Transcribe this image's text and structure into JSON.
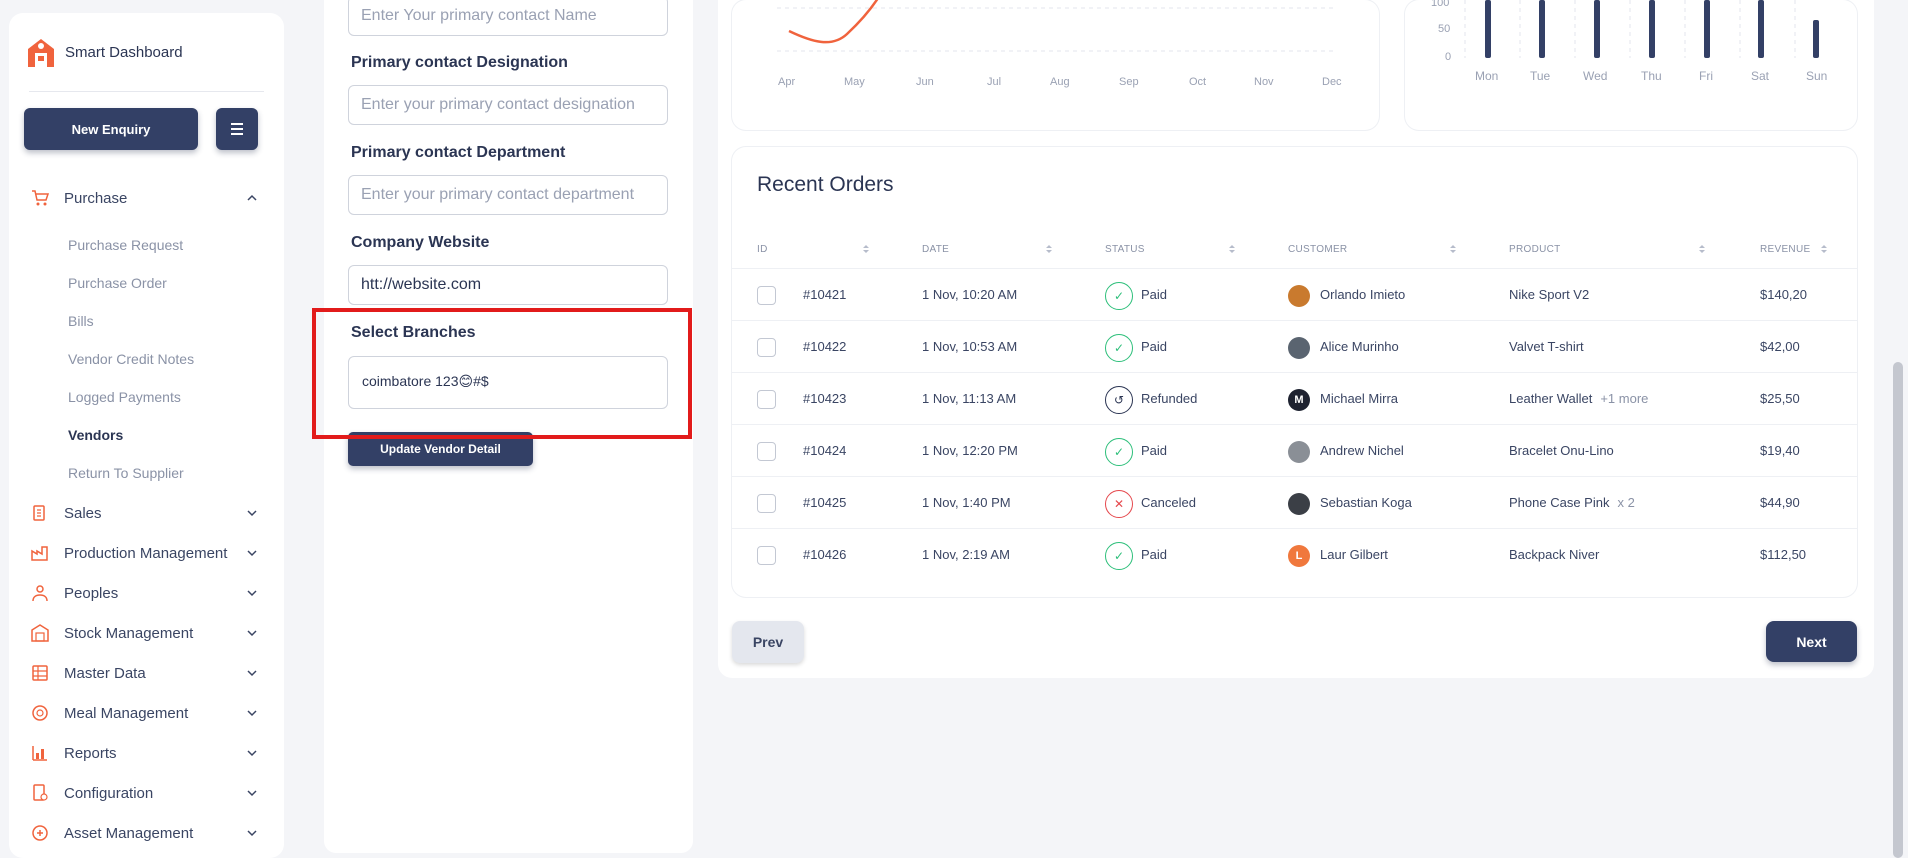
{
  "app": {
    "title": "Smart Dashboard"
  },
  "colors": {
    "primary": "#334066",
    "accent": "#f0633d",
    "success": "#2dbf7a",
    "danger": "#e5484d",
    "highlight": "#e21b1b"
  },
  "sidebar": {
    "new_enquiry_label": "New Enquiry",
    "menu": [
      {
        "label": "Purchase",
        "icon": "cart-icon",
        "expanded": true,
        "children": [
          "Purchase Request",
          "Purchase Order",
          "Bills",
          "Vendor Credit Notes",
          "Logged Payments",
          "Vendors",
          "Return To Supplier"
        ],
        "active_child": "Vendors"
      },
      {
        "label": "Sales",
        "icon": "sales-icon"
      },
      {
        "label": "Production Management",
        "icon": "factory-icon"
      },
      {
        "label": "Peoples",
        "icon": "people-icon"
      },
      {
        "label": "Stock Management",
        "icon": "warehouse-icon"
      },
      {
        "label": "Master Data",
        "icon": "database-icon"
      },
      {
        "label": "Meal Management",
        "icon": "meal-icon"
      },
      {
        "label": "Reports",
        "icon": "reports-icon"
      },
      {
        "label": "Configuration",
        "icon": "config-icon"
      },
      {
        "label": "Asset Management",
        "icon": "asset-icon"
      }
    ]
  },
  "form": {
    "contact_name_placeholder": "Enter Your primary contact Name",
    "designation_label": "Primary contact Designation",
    "designation_placeholder": "Enter your primary contact designation",
    "department_label": "Primary contact Department",
    "department_placeholder": "Enter your primary contact department",
    "website_label": "Company Website",
    "website_value": "htt://website.com",
    "branches_label": "Select Branches",
    "branches_value": "coimbatore 123😊#$",
    "update_button": "Update Vendor Detail"
  },
  "line_chart": {
    "months": [
      "Apr",
      "May",
      "Jun",
      "Jul",
      "Aug",
      "Sep",
      "Oct",
      "Nov",
      "Dec"
    ]
  },
  "bar_chart": {
    "y_ticks": [
      "100",
      "50",
      "0"
    ],
    "days": [
      "Mon",
      "Tue",
      "Wed",
      "Thu",
      "Fri",
      "Sat",
      "Sun"
    ]
  },
  "orders": {
    "title": "Recent Orders",
    "columns": [
      "ID",
      "DATE",
      "STATUS",
      "CUSTOMER",
      "PRODUCT",
      "REVENUE"
    ],
    "rows": [
      {
        "id": "#10421",
        "date": "1 Nov, 10:20 AM",
        "status": "Paid",
        "customer": "Orlando Imieto",
        "product": "Nike Sport V2",
        "extra": "",
        "revenue": "$140,20"
      },
      {
        "id": "#10422",
        "date": "1 Nov, 10:53 AM",
        "status": "Paid",
        "customer": "Alice Murinho",
        "product": "Valvet T-shirt",
        "extra": "",
        "revenue": "$42,00"
      },
      {
        "id": "#10423",
        "date": "1 Nov, 11:13 AM",
        "status": "Refunded",
        "customer": "Michael Mirra",
        "product": "Leather Wallet",
        "extra": "+1 more",
        "revenue": "$25,50"
      },
      {
        "id": "#10424",
        "date": "1 Nov, 12:20 PM",
        "status": "Paid",
        "customer": "Andrew Nichel",
        "product": "Bracelet Onu-Lino",
        "extra": "",
        "revenue": "$19,40"
      },
      {
        "id": "#10425",
        "date": "1 Nov, 1:40 PM",
        "status": "Canceled",
        "customer": "Sebastian Koga",
        "product": "Phone Case Pink",
        "extra": "x 2",
        "revenue": "$44,90"
      },
      {
        "id": "#10426",
        "date": "1 Nov, 2:19 AM",
        "status": "Paid",
        "customer": "Laur Gilbert",
        "product": "Backpack Niver",
        "extra": "",
        "revenue": "$112,50"
      }
    ],
    "avatar_initials": [
      "",
      "",
      "M",
      "",
      "",
      "L"
    ]
  },
  "pagination": {
    "prev": "Prev",
    "next": "Next"
  }
}
